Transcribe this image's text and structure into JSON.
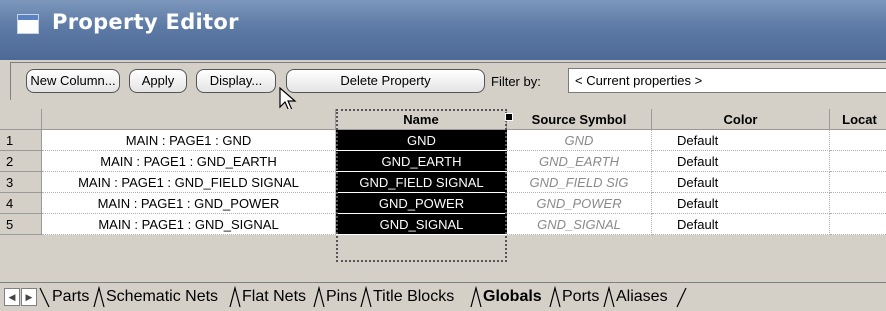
{
  "window": {
    "title": "Property Editor"
  },
  "toolbar": {
    "buttons": [
      "New Column...",
      "Apply",
      "Display...",
      "Delete Property"
    ],
    "filter_label": "Filter by:",
    "filter_value": "< Current properties >"
  },
  "grid": {
    "columns": [
      "",
      "",
      "Name",
      "Source Symbol",
      "Color",
      "Locat"
    ],
    "rows": [
      {
        "num": "1",
        "path": "MAIN : PAGE1 : GND",
        "name": "GND",
        "source": "GND",
        "color": "Default"
      },
      {
        "num": "2",
        "path": "MAIN : PAGE1 : GND_EARTH",
        "name": "GND_EARTH",
        "source": "GND_EARTH",
        "color": "Default"
      },
      {
        "num": "3",
        "path": "MAIN : PAGE1 : GND_FIELD SIGNAL",
        "name": "GND_FIELD SIGNAL",
        "source": "GND_FIELD SIG",
        "color": "Default"
      },
      {
        "num": "4",
        "path": "MAIN : PAGE1 : GND_POWER",
        "name": "GND_POWER",
        "source": "GND_POWER",
        "color": "Default"
      },
      {
        "num": "5",
        "path": "MAIN : PAGE1 : GND_SIGNAL",
        "name": "GND_SIGNAL",
        "source": "GND_SIGNAL",
        "color": "Default"
      }
    ]
  },
  "tabs": {
    "items": [
      "Parts",
      "Schematic Nets",
      "Flat Nets",
      "Pins",
      "Title Blocks",
      "Globals",
      "Ports",
      "Aliases"
    ],
    "active": "Globals"
  },
  "colors": {
    "title_bar": "#5d7aa6",
    "selection_bg": "#000000",
    "source_text": "#8a8a8a"
  },
  "icons": [
    "window-icon",
    "mouse-cursor-icon",
    "first-tab-arrow-icon",
    "last-tab-arrow-icon"
  ]
}
